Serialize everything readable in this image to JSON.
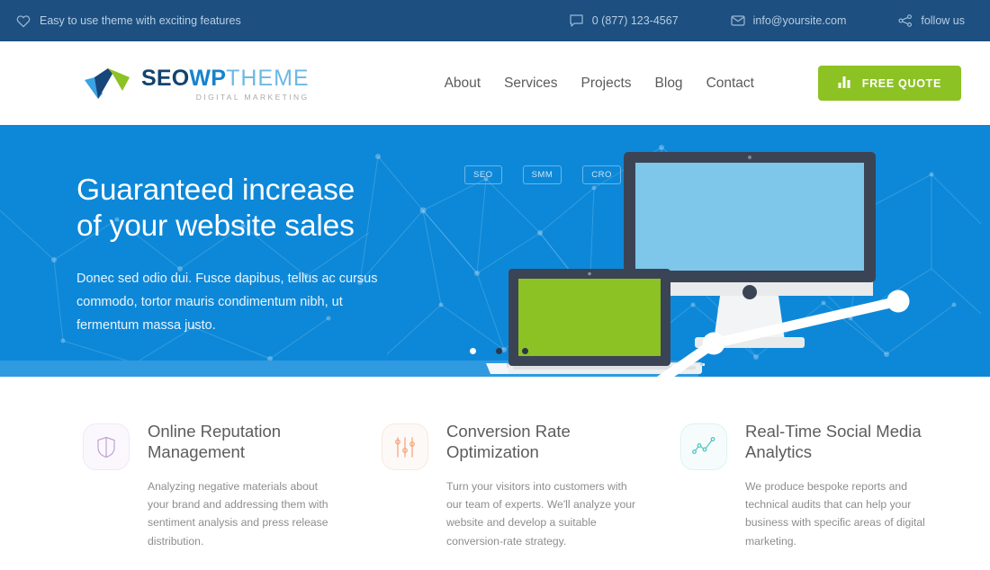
{
  "topbar": {
    "tagline": "Easy to use theme with exciting features",
    "tagline_icon": "heart-icon",
    "phone": "0 (877) 123-4567",
    "phone_icon": "chat-bubble-icon",
    "email": "info@yoursite.com",
    "email_icon": "envelope-icon",
    "social": "follow us",
    "social_icon": "share-nodes-icon"
  },
  "header": {
    "logo": {
      "part1": "SEO",
      "part2": "WP",
      "part3": "THEME",
      "subtitle": "DIGITAL MARKETING",
      "mark_icon": "checkmark-arrow-logo-icon"
    },
    "nav": [
      {
        "label": "About"
      },
      {
        "label": "Services"
      },
      {
        "label": "Projects"
      },
      {
        "label": "Blog"
      },
      {
        "label": "Contact"
      }
    ],
    "cta": {
      "label": "FREE QUOTE",
      "icon": "bar-chart-icon",
      "color": "#8cc224"
    }
  },
  "hero": {
    "title_line1": "Guaranteed increase",
    "title_line2": "of your website sales",
    "subtitle": "Donec sed odio dui. Fusce dapibus, tellus ac cursus commodo, tortor mauris condimentum nibh, ut fermentum massa justo.",
    "badges": [
      "SEO",
      "SMM",
      "CRO"
    ],
    "background_color": "#0d88d8",
    "slider_dots": [
      {
        "active": true
      },
      {
        "active": false
      },
      {
        "active": false
      }
    ],
    "illustration": {
      "monitor_screen_color": "#7ec6ea",
      "laptop_screen_color": "#8cc224",
      "bezel_color": "#3b4455",
      "line_color": "#ffffff"
    }
  },
  "features": [
    {
      "icon": "shield-icon",
      "icon_color": "#b9a0cf",
      "icon_bg": "#fbf8fd",
      "icon_border": "#f0e8f6",
      "title": "Online Reputation Management",
      "description": "Analyzing negative materials about your brand and addressing them with sentiment analysis and press release distribution."
    },
    {
      "icon": "sliders-icon",
      "icon_color": "#f2a477",
      "icon_bg": "#fdf9f6",
      "icon_border": "#fae9dd",
      "title": "Conversion Rate Optimization",
      "description": "Turn your visitors into customers with our team of experts. We'll analyze your website and develop a suitable conversion-rate strategy."
    },
    {
      "icon": "line-chart-icon",
      "icon_color": "#5cc6c0",
      "icon_bg": "#f6fcfc",
      "icon_border": "#ddf2f1",
      "title": "Real-Time Social Media Analytics",
      "description": "We produce bespoke reports and technical audits that can help your business with specific areas of digital marketing."
    }
  ]
}
